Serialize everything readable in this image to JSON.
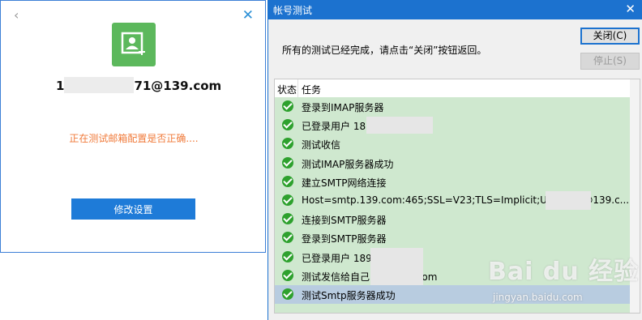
{
  "left": {
    "email": "1            71@139.com",
    "email_prefix": "1",
    "email_suffix": "71@139.com",
    "status": "正在测试邮箱配置是否正确....",
    "modify_label": "修改设置",
    "back": "‹",
    "close": "✕"
  },
  "dialog": {
    "title": "帐号测试",
    "close_glyph": "✕",
    "message": "所有的测试已经完成，请点击“关闭”按钮返回。",
    "close_btn": "关闭(C)",
    "stop_btn": "停止(S)",
    "columns": {
      "status": "状态",
      "task": "任务"
    },
    "rows": [
      "登录到IMAP服务器",
      "已登录用户 18          1@139.com",
      "测试收信",
      "测试IMAP服务器成功",
      "建立SMTP网络连接",
      "Host=smtp.139.com:465;SSL=V23;TLS=Implicit;U=18          71@139.c...",
      "连接到SMTP服务器",
      "登录到SMTP服务器",
      "已登录用户 189           139.com",
      "测试发信给自己          71@139.com",
      "测试Smtp服务器成功"
    ]
  },
  "watermark": {
    "brand": "Bai du 经验",
    "url": "jingyan.baidu.com"
  },
  "colors": {
    "titlebar": "#1c72cf",
    "list_bg": "#cfe8cf",
    "selected_row": "#b8cce0",
    "accent_orange": "#f07a3a",
    "button_blue": "#1e7bd8",
    "avatar_green": "#5cb85c"
  }
}
